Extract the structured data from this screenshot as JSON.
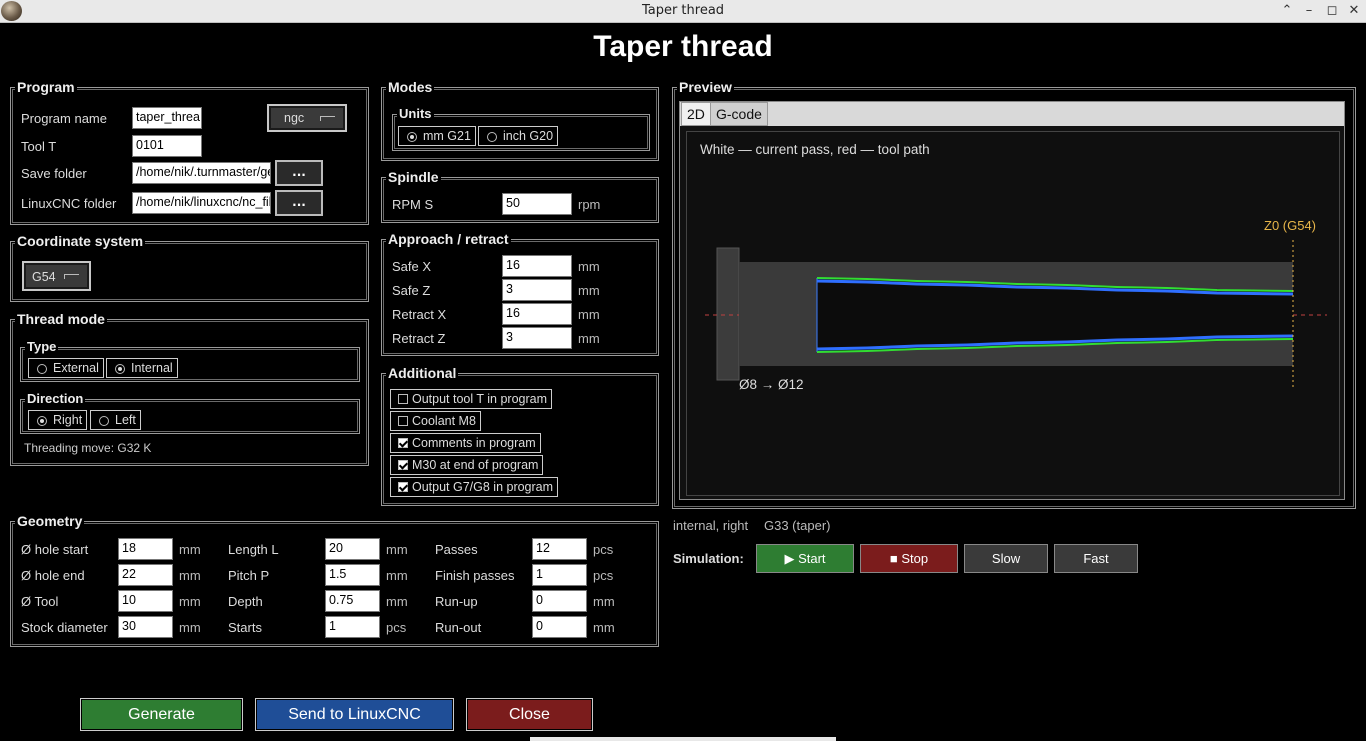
{
  "window": {
    "title": "Taper thread"
  },
  "heading": "Taper thread",
  "program": {
    "group_label": "Program",
    "name_label": "Program name",
    "name_value": "taper_threa",
    "ext_value": "ngc",
    "tool_label": "Tool T",
    "tool_value": "0101",
    "save_label": "Save folder",
    "save_value": "/home/nik/.turnmaster/ge",
    "linuxcnc_label": "LinuxCNC folder",
    "linuxcnc_value": "/home/nik/linuxcnc/nc_fil",
    "browse_label": "..."
  },
  "coord": {
    "group_label": "Coordinate system",
    "value": "G54"
  },
  "thread_mode": {
    "group_label": "Thread mode",
    "type_label": "Type",
    "external_label": "External",
    "internal_label": "Internal",
    "direction_label": "Direction",
    "right_label": "Right",
    "left_label": "Left",
    "move_text": "Threading move: G32 K"
  },
  "modes": {
    "group_label": "Modes",
    "units_label": "Units",
    "mm_label": "mm G21",
    "inch_label": "inch G20"
  },
  "spindle": {
    "group_label": "Spindle",
    "rpm_label": "RPM S",
    "rpm_value": "50",
    "rpm_unit": "rpm"
  },
  "approach": {
    "group_label": "Approach / retract",
    "safe_x_label": "Safe X",
    "safe_x_value": "16",
    "safe_z_label": "Safe Z",
    "safe_z_value": "3",
    "retract_x_label": "Retract X",
    "retract_x_value": "16",
    "retract_z_label": "Retract Z",
    "retract_z_value": "3",
    "unit": "mm"
  },
  "additional": {
    "group_label": "Additional",
    "items": [
      {
        "label": "Output tool T in program",
        "checked": false
      },
      {
        "label": "Coolant M8",
        "checked": false
      },
      {
        "label": "Comments in program",
        "checked": true
      },
      {
        "label": "M30 at end of program",
        "checked": true
      },
      {
        "label": "Output G7/G8 in program",
        "checked": true
      }
    ]
  },
  "geometry": {
    "group_label": "Geometry",
    "hole_start_label": "Ø hole start",
    "hole_start_value": "18",
    "hole_end_label": "Ø hole end",
    "hole_end_value": "22",
    "tool_label": "Ø Tool",
    "tool_value": "10",
    "stock_label": "Stock diameter",
    "stock_value": "30",
    "length_label": "Length L",
    "length_value": "20",
    "pitch_label": "Pitch P",
    "pitch_value": "1.5",
    "depth_label": "Depth",
    "depth_value": "0.75",
    "starts_label": "Starts",
    "starts_value": "1",
    "passes_label": "Passes",
    "passes_value": "12",
    "finish_label": "Finish passes",
    "finish_value": "1",
    "runup_label": "Run-up",
    "runup_value": "0",
    "runout_label": "Run-out",
    "runout_value": "0",
    "mm": "mm",
    "pcs": "pcs"
  },
  "preview": {
    "group_label": "Preview",
    "tab_2d": "2D",
    "tab_gcode": "G-code",
    "legend": "White — current pass, red — tool path",
    "z0_label": "Z0 (G54)",
    "dia_label": "Ø8 → Ø12",
    "status_mode": "internal, right",
    "status_cmd": "G33 (taper)"
  },
  "simulation": {
    "label": "Simulation:",
    "start": "▶ Start",
    "stop": "■ Stop",
    "slow": "Slow",
    "fast": "Fast"
  },
  "actions": {
    "generate": "Generate",
    "send": "Send to LinuxCNC",
    "close": "Close"
  },
  "colors": {
    "green_btn": "#2e7d32",
    "red_btn": "#7b1c1c",
    "blue_btn": "#1f4e97",
    "z0": "#e8b64a"
  }
}
